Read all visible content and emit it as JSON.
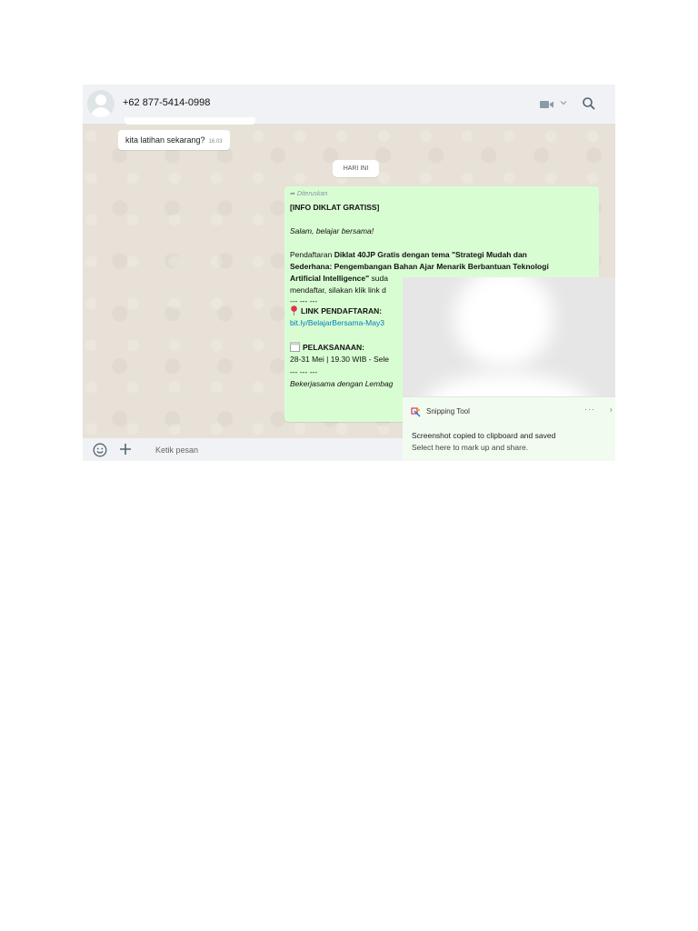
{
  "header": {
    "contact": "+62 877-5414-0998",
    "icons": [
      "avatar-placeholder",
      "video-call-icon",
      "chevron-down-icon",
      "search-icon"
    ]
  },
  "chat": {
    "incoming": {
      "text": "kita latihan sekarang?",
      "time": "16.03"
    },
    "date_chip": "HARI INI",
    "outgoing": {
      "forwarded_label": "Diteruskan",
      "title": "[INFO DIKLAT GRATISS]",
      "greeting": "Salam, belajar bersama!",
      "para_line1_prefix": "Pendaftaran ",
      "para_line1_bold": "Diklat 40JP Gratis dengan tema \"Strategi Mudah dan",
      "para_line2": "Sederhana: Pengembangan Bahan Ajar Menarik Berbantuan Teknologi",
      "para_line3_bold": "Artificial Intelligence\"",
      "para_line3_rest": " suda",
      "para_line4": "mendaftar, silakan klik link d",
      "separator": "--- --- ---",
      "link_label": "LINK PENDAFTARAN:",
      "link_url": "bit.ly/BelajarBersama-May3",
      "pelaksanaan_label": "PELAKSANAAN:",
      "pelaksanaan_date": "28-31 Mei | 19.30 WIB - Sele",
      "separator2": "--- --- ---",
      "collab": "Bekerjasama dengan Lembag"
    }
  },
  "composer": {
    "placeholder": "Ketik pesan"
  },
  "toast": {
    "app_name": "Snipping Tool",
    "more": "···",
    "close": "›",
    "line1": "Screenshot copied to clipboard and saved",
    "line2": "Select here to mark up and share."
  },
  "colors": {
    "outgoing_bubble": "#d9fdd3",
    "link": "#027eb5",
    "header": "#f0f2f5",
    "chat_bg": "#e7e1d7"
  }
}
